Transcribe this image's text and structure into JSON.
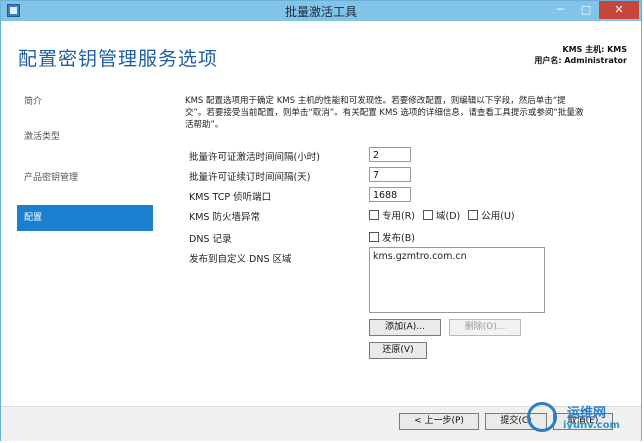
{
  "window": {
    "title": "批量激活工具"
  },
  "header": {
    "page_title": "配置密钥管理服务选项",
    "kms_host": "KMS 主机: KMS",
    "user_name": "用户名: Administrator"
  },
  "sidebar": {
    "items": [
      {
        "label": "简介"
      },
      {
        "label": "激活类型"
      },
      {
        "label": "产品密钥管理"
      },
      {
        "label": "配置",
        "active": true
      }
    ]
  },
  "content": {
    "description": "KMS 配置选项用于确定 KMS 主机的性能和可发现性。若要修改配置，则编辑以下字段，然后单击“提交”。若要接受当前配置，则单击“取消”。有关配置 KMS 选项的详细信息，请查看工具提示或参阅“批量激活帮助”。",
    "fields": {
      "activation_interval": {
        "label": "批量许可证激活时间间隔(小时)",
        "value": "2"
      },
      "renewal_interval": {
        "label": "批量许可证续订时间间隔(天)",
        "value": "7"
      },
      "tcp_port": {
        "label": "KMS TCP 侦听端口",
        "value": "1688"
      },
      "firewall": {
        "label": "KMS 防火墙异常",
        "options": [
          {
            "label": "专用(R)",
            "checked": false
          },
          {
            "label": "域(D)",
            "checked": false
          },
          {
            "label": "公用(U)",
            "checked": false
          }
        ]
      },
      "dns_records": {
        "label": "DNS 记录",
        "option": {
          "label": "发布(B)",
          "checked": false
        }
      },
      "custom_dns": {
        "label": "发布到自定义 DNS 区域",
        "value": "kms.gzmtro.com.cn"
      }
    },
    "buttons": {
      "add": "添加(A)...",
      "remove": "删除(O)...",
      "restore": "还原(V)"
    }
  },
  "footer": {
    "back": "< 上一步(P)",
    "submit": "提交(C)",
    "cancel": "取消(E)"
  },
  "watermark": {
    "line1": "运维网",
    "line2": "iyunv.com"
  }
}
